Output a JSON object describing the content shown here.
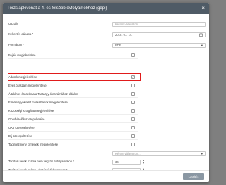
{
  "dialog": {
    "title": "Törzslapkivonat a 4. és felsőbb évfolyamokhoz (gépi)",
    "close": "×"
  },
  "form": {
    "osztaly": {
      "label": "Osztály",
      "placeholder": "Kérem válasszon..."
    },
    "date": {
      "label": "Kelteztés dátuma *",
      "value": "2018. 01. 14."
    },
    "format": {
      "label": "Formátum *",
      "value": "PDF"
    }
  },
  "checkboxes": [
    {
      "label": "Fejléc megjelenítése",
      "checked": false
    },
    {
      "label": "Adatok megjelenítése",
      "checked": true
    },
    {
      "label": "Éves óraszám megjelenítése",
      "checked": false
    },
    {
      "label": "Általános óraszáma a Tantárgy óraszámához oldalon",
      "checked": false
    },
    {
      "label": "Elmélet/gyakorlat mulasztások megjelenítése",
      "checked": false
    },
    {
      "label": "Közösségi szolgálat megjelenítése",
      "checked": false
    },
    {
      "label": "Gondviselők szerepeltetése",
      "checked": false
    },
    {
      "label": "OKJ szerepeltetése",
      "checked": false
    },
    {
      "label": "Díj szerepeltetése",
      "checked": false
    },
    {
      "label": "Tagintézmény címének megjelenítése",
      "checked": false
    }
  ],
  "select_extra": {
    "placeholder": "Kérem válasszon..."
  },
  "weeks_nonfinal": {
    "label": "Tanítási hetek száma nem végzős évfolyamokon *",
    "value": "36"
  },
  "weeks_final": {
    "label": "Tanítási hetek száma végzős évfolyamokon *",
    "value": "32"
  },
  "footer": {
    "button": "Letöltés"
  },
  "icons": {
    "calendar": "calendar-icon",
    "caret": "caret-down-icon"
  }
}
